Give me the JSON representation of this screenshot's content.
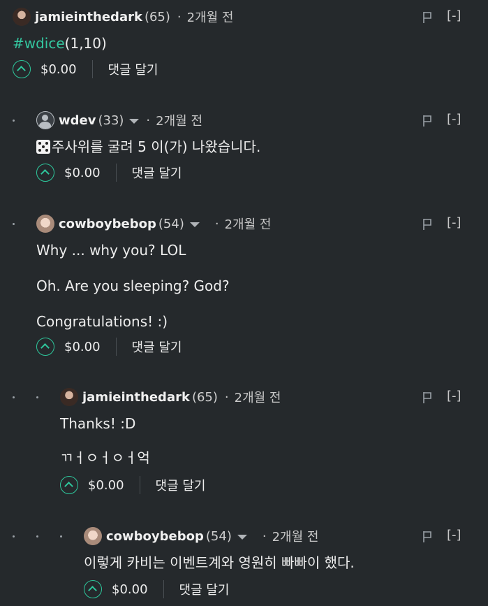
{
  "comments": [
    {
      "username": "jamieinthedark",
      "rep": "(65)",
      "sep": "·",
      "time": "2개월 전",
      "collapse": "[-]",
      "body": {
        "tag": "#wdice",
        "rest": "(1,10)"
      },
      "payout": "$0.00",
      "reply": "댓글 달기"
    },
    {
      "username": "wdev",
      "rep": "(33)",
      "sep": "·",
      "time": "2개월 전",
      "collapse": "[-]",
      "body_lines": [
        "주사위를 굴려 5 이(가) 나왔습니다."
      ],
      "payout": "$0.00",
      "reply": "댓글 달기"
    },
    {
      "username": "cowboybebop",
      "rep": "(54)",
      "sep": "·",
      "time": "2개월 전",
      "collapse": "[-]",
      "body_lines": [
        "Why ... why you? LOL",
        "Oh. Are you sleeping? God?",
        "Congratulations! :)"
      ],
      "payout": "$0.00",
      "reply": "댓글 달기"
    },
    {
      "username": "jamieinthedark",
      "rep": "(65)",
      "sep": "·",
      "time": "2개월 전",
      "collapse": "[-]",
      "body_lines": [
        "Thanks! :D",
        "ㄲㅓㅇㅓㅇㅓ억"
      ],
      "payout": "$0.00",
      "reply": "댓글 달기"
    },
    {
      "username": "cowboybebop",
      "rep": "(54)",
      "sep": "·",
      "time": "2개월 전",
      "collapse": "[-]",
      "body_lines": [
        "이렇게 카비는 이벤트계와 영원히 빠빠이 했다."
      ],
      "payout": "$0.00",
      "reply": "댓글 달기"
    }
  ],
  "colors": {
    "background": "#25292c",
    "accent": "#2ec79c",
    "text": "#ededed"
  }
}
